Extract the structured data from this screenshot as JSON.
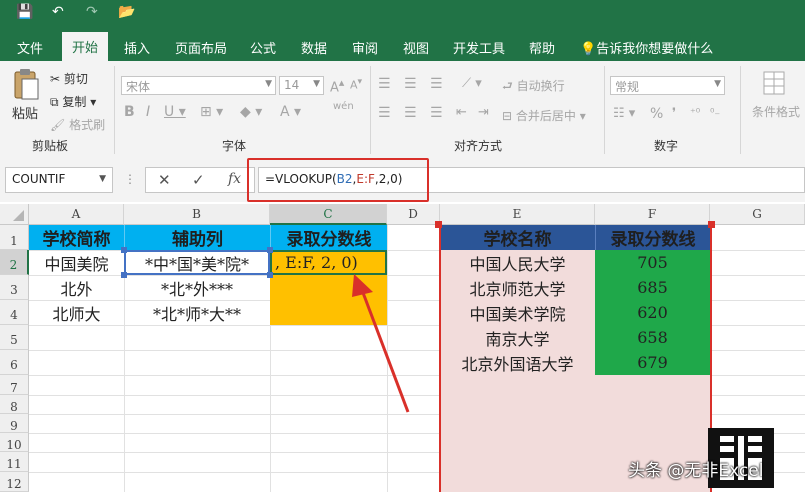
{
  "qat": {
    "save": "💾",
    "undo": "↶",
    "redo": "↷",
    "open": "📂"
  },
  "tabs": [
    "文件",
    "开始",
    "插入",
    "页面布局",
    "公式",
    "数据",
    "审阅",
    "视图",
    "开发工具",
    "帮助"
  ],
  "tell_me": "告诉我你想要做什么",
  "ribbon": {
    "clipboard": {
      "paste": "粘贴",
      "cut": "剪切",
      "copy": "复制",
      "format_painter": "格式刷",
      "group": "剪贴板"
    },
    "font": {
      "name": "宋体",
      "size": "14",
      "group": "字体",
      "wen": "wén"
    },
    "align": {
      "wrap": "自动换行",
      "merge": "合并后居中",
      "group": "对齐方式"
    },
    "number": {
      "format": "常规",
      "group": "数字",
      "percent": "%"
    },
    "styles": {
      "cond": "条件格式"
    }
  },
  "namebox": "COUNTIF",
  "formula": {
    "prefix": "=VLOOKUP(",
    "ref1": "B2",
    "sep1": ",",
    "ref2": "E:F",
    "rest": ",2,0)"
  },
  "columns": [
    "A",
    "B",
    "C",
    "D",
    "E",
    "F",
    "G"
  ],
  "rows": [
    "1",
    "2",
    "3",
    "4",
    "5",
    "6",
    "7",
    "8",
    "9",
    "10",
    "11",
    "12"
  ],
  "left_table": {
    "headers": [
      "学校简称",
      "辅助列",
      "录取分数线"
    ],
    "rows": [
      [
        "中国美院",
        "*中*国*美*院*",
        ", E:F, 2, 0)"
      ],
      [
        "北外",
        "*北*外***",
        ""
      ],
      [
        "北师大",
        "*北*师*大**",
        ""
      ]
    ]
  },
  "right_table": {
    "headers": [
      "学校名称",
      "录取分数线"
    ],
    "rows": [
      [
        "中国人民大学",
        "705"
      ],
      [
        "北京师范大学",
        "685"
      ],
      [
        "中国美术学院",
        "620"
      ],
      [
        "南京大学",
        "658"
      ],
      [
        "北京外国语大学",
        "679"
      ]
    ]
  },
  "watermark": "头条 @无非Excel",
  "colors": {
    "excel_green": "#217346",
    "header_blue": "#00b0f0",
    "orange": "#ffc000",
    "pink": "#f2dcdb",
    "green": "#1fa84a",
    "dark_blue": "#2b5597",
    "red": "#d9302a"
  }
}
